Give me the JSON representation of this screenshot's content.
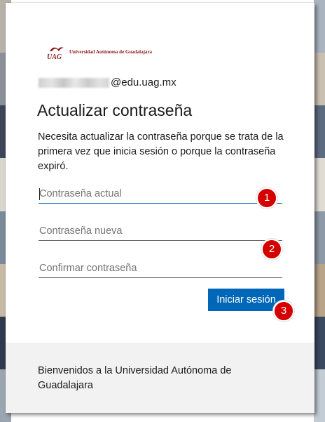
{
  "colors": {
    "accent": "#0067b8",
    "brand": "#8b1a1e",
    "badge": "#d40000",
    "footer_bg": "#f2f2f2",
    "background_left_strip": [
      "#b8b1a7",
      "#8a8f98",
      "#3d4658",
      "#d9d6d0",
      "#7b8a9a",
      "#c7b9a4",
      "#2f3a4f",
      "#9aa5b1"
    ],
    "background_right_strip": [
      "#a9b4c0",
      "#c9c0b2",
      "#5d6b80",
      "#e0dcd4",
      "#8d99a6",
      "#b9a48a",
      "#3a4860",
      "#c3cbd4"
    ]
  },
  "logo": {
    "mark_text": "UAG",
    "name": "Universidad Autónoma de Guadalajara",
    "icon": "uag-logo-icon"
  },
  "identity": {
    "email_suffix": "@edu.uag.mx",
    "username_redacted": true
  },
  "page": {
    "title": "Actualizar contraseña",
    "description": "Necesita actualizar la contraseña porque se trata de la primera vez que inicia sesión o porque la contraseña expiró."
  },
  "form": {
    "current_password": {
      "placeholder": "Contraseña actual",
      "value": ""
    },
    "new_password": {
      "placeholder": "Contraseña nueva",
      "value": ""
    },
    "confirm_password": {
      "placeholder": "Confirmar contraseña",
      "value": ""
    },
    "submit_label": "Iniciar sesión"
  },
  "annotations": {
    "step1": "1",
    "step2": "2",
    "step3": "3"
  },
  "footer": {
    "text": "Bienvenidos a la Universidad Autónoma de Guadalajara"
  }
}
